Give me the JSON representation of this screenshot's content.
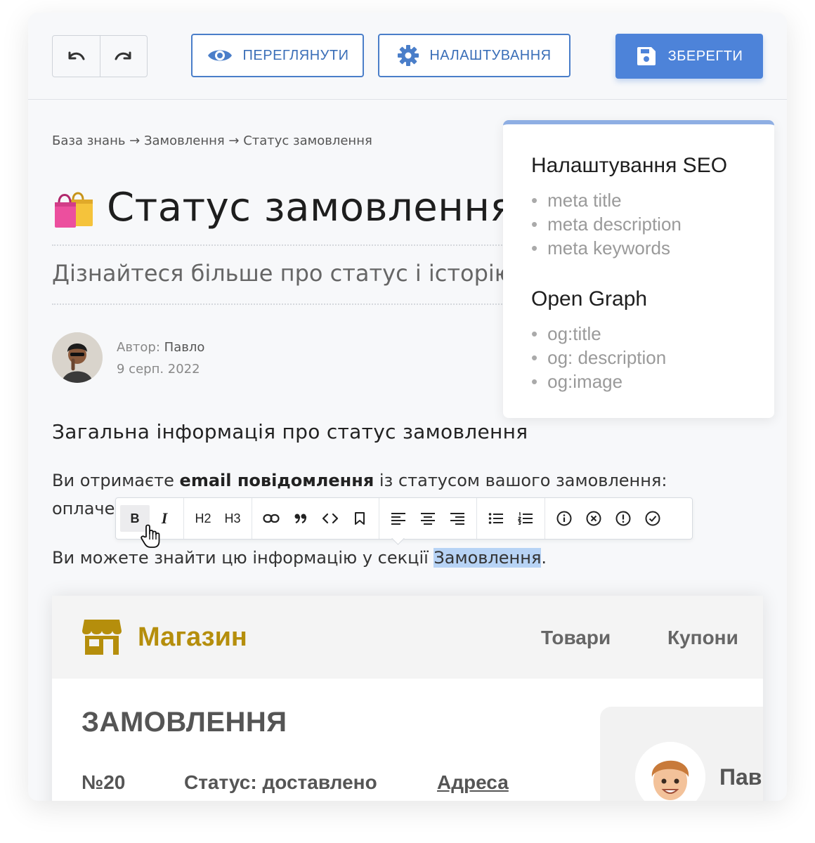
{
  "toolbar": {
    "preview_label": "ПЕРЕГЛЯНУТИ",
    "settings_label": "НАЛАШТУВАННЯ",
    "save_label": "ЗБЕРЕГТИ",
    "accent_color": "#4d83d9"
  },
  "article": {
    "breadcrumb": "База знань → Замовлення → Статус замовлення",
    "title_emoji": "shopping-bags-icon",
    "title": "Статус замовлення",
    "subtitle": "Дізнайтеся більше про статус і історію",
    "author_label": "Автор:",
    "author_name": "Павло",
    "date": "9 серп. 2022",
    "section_heading": "Загальна інформація про статус замовлення",
    "para1_before": "Ви отримаєте ",
    "para1_bold": "email повідомлення",
    "para1_after": " із статусом вашого замовлення:",
    "para1_line2": "оплаче",
    "para2_before": "Ви можете знайти цю інформацію у секції ",
    "para2_highlight": "Замовлення",
    "para2_after": "."
  },
  "format_toolbar": {
    "bold": "B",
    "italic": "I",
    "h2": "H2",
    "h3": "H3"
  },
  "seo_panel": {
    "seo_heading": "Налаштування SEO",
    "seo_items": [
      "meta title",
      "meta description",
      "meta keywords"
    ],
    "og_heading": "Open Graph",
    "og_items": [
      "og:title",
      "og: description",
      "og:image"
    ]
  },
  "shop": {
    "name": "Магазин",
    "nav": [
      "Товари",
      "Купони"
    ],
    "orders_heading": "ЗАМОВЛЕННЯ",
    "order_number": "№20",
    "order_status": "Статус: доставлено",
    "address_link": "Адреса",
    "user_name": "Пав",
    "brand_color": "#b58e0c"
  }
}
